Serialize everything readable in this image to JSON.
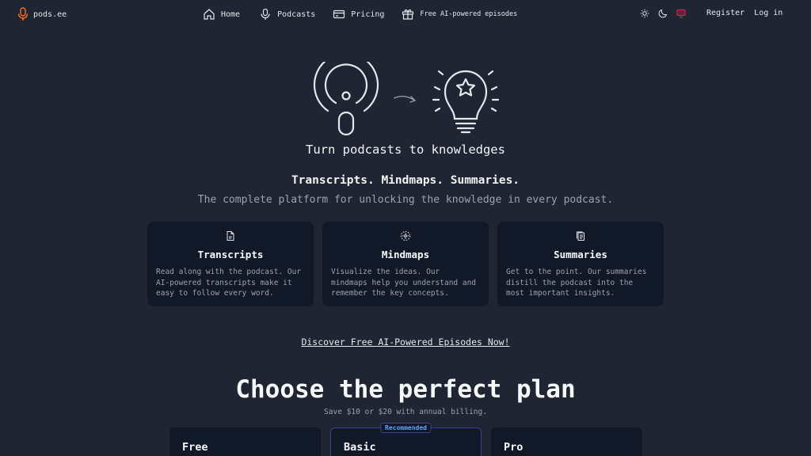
{
  "brand": {
    "name": "pods.ee",
    "accent": "#f97316"
  },
  "nav": [
    {
      "label": "Home",
      "icon": "home-icon"
    },
    {
      "label": "Podcasts",
      "icon": "microphone-icon"
    },
    {
      "label": "Pricing",
      "icon": "credit-card-icon"
    },
    {
      "label": "Free AI-powered episodes",
      "icon": "gift-icon"
    }
  ],
  "theme": {
    "icons": [
      "sun-icon",
      "moon-icon",
      "monitor-icon"
    ],
    "active": "monitor-icon",
    "active_color": "#e11d48"
  },
  "auth": {
    "register": "Register",
    "login": "Log in"
  },
  "hero": {
    "title": "Turn podcasts to knowledges",
    "tagline": "Transcripts. Mindmaps. Summaries.",
    "subtitle": "The complete platform for unlocking the knowledge in every podcast."
  },
  "features": [
    {
      "icon": "document-icon",
      "title": "Transcripts",
      "desc": "Read along with the podcast. Our AI-powered transcripts make it easy to follow every word."
    },
    {
      "icon": "mindmap-icon",
      "title": "Mindmaps",
      "desc": "Visualize the ideas. Our mindmaps help you understand and remember the key concepts."
    },
    {
      "icon": "copy-icon",
      "title": "Summaries",
      "desc": "Get to the point. Our summaries distill the podcast into the most important insights."
    }
  ],
  "discover": "Discover Free AI-Powered Episodes Now!",
  "plans": {
    "title": "Choose the perfect plan",
    "subtitle": "Save $10 or $20 with annual billing.",
    "items": [
      {
        "name": "Free"
      },
      {
        "name": "Basic",
        "badge": "Recommended"
      },
      {
        "name": "Pro"
      }
    ]
  }
}
